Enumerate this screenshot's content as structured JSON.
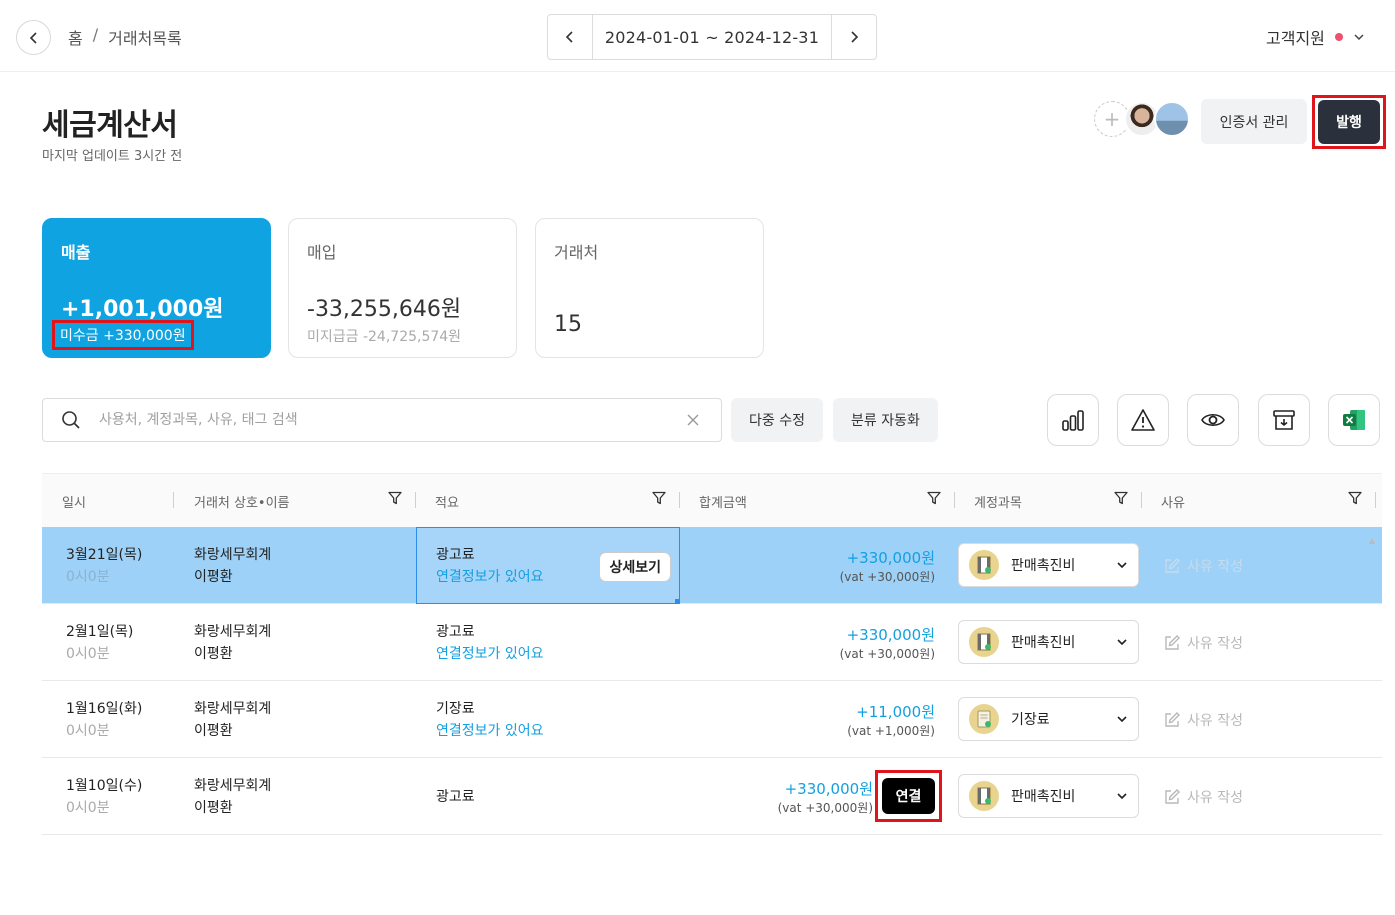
{
  "topbar": {
    "breadcrumb": [
      "홈",
      "/",
      "거래처목록"
    ],
    "date_range": "2024-01-01 ~ 2024-12-31",
    "support_label": "고객지원"
  },
  "header": {
    "title": "세금계산서",
    "subtitle": "마지막 업데이트 3시간 전",
    "cert_button": "인증서 관리",
    "issue_button": "발행"
  },
  "cards": [
    {
      "label": "매출",
      "amount": "+1,001,000원",
      "sub": "미수금 +330,000원"
    },
    {
      "label": "매입",
      "amount": "-33,255,646원",
      "sub": "미지급금 -24,725,574원"
    },
    {
      "label": "거래처",
      "amount": "15"
    }
  ],
  "toolbar": {
    "search_placeholder": "사용처, 계정과목, 사유, 태그 검색",
    "bulk_edit": "다중 수정",
    "auto_classify": "분류 자동화"
  },
  "table": {
    "headers": [
      "일시",
      "거래처 상호•이름",
      "적요",
      "합계금액",
      "계정과목",
      "사유"
    ],
    "detail_button": "상세보기",
    "connect_button": "연결",
    "reason_placeholder": "사유 작성",
    "rows": [
      {
        "date": "3월21일(목)",
        "time": "0시0분",
        "company": "화랑세무회계",
        "person": "이평환",
        "memo": "광고료",
        "memo_link": "연결정보가 있어요",
        "amount": "+330,000원",
        "vat": "(vat +30,000원)",
        "account": "판매촉진비"
      },
      {
        "date": "2월1일(목)",
        "time": "0시0분",
        "company": "화랑세무회계",
        "person": "이평환",
        "memo": "광고료",
        "memo_link": "연결정보가 있어요",
        "amount": "+330,000원",
        "vat": "(vat +30,000원)",
        "account": "판매촉진비"
      },
      {
        "date": "1월16일(화)",
        "time": "0시0분",
        "company": "화랑세무회계",
        "person": "이평환",
        "memo": "기장료",
        "memo_link": "연결정보가 있어요",
        "amount": "+11,000원",
        "vat": "(vat +1,000원)",
        "account": "기장료"
      },
      {
        "date": "1월10일(수)",
        "time": "0시0분",
        "company": "화랑세무회계",
        "person": "이평환",
        "memo": "광고료",
        "memo_link": "",
        "amount": "+330,000원",
        "vat": "(vat +30,000원)",
        "account": "판매촉진비"
      }
    ]
  },
  "colors": {
    "accent": "#0fa3e2",
    "highlight": "#e0151b",
    "selected_row": "#9dd1f7",
    "dark_button": "#2a313c"
  }
}
